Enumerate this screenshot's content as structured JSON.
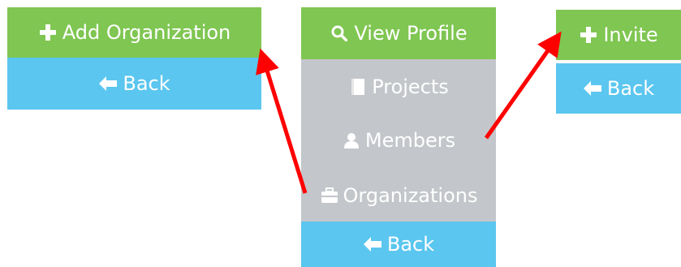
{
  "left": {
    "add_label": "Add Organization",
    "back_label": "Back"
  },
  "middle": {
    "view_profile_label": "View Profile",
    "projects_label": "Projects",
    "members_label": "Members",
    "organizations_label": "Organizations",
    "back_label": "Back"
  },
  "right": {
    "invite_label": "Invite",
    "back_label": "Back"
  },
  "icons": {
    "plus": "plus-icon",
    "back_arrow": "arrow-left-icon",
    "search": "search-icon",
    "book": "book-icon",
    "user": "user-icon",
    "briefcase": "briefcase-icon"
  },
  "colors": {
    "primary_green": "#7fc652",
    "back_blue": "#5bc6ef",
    "menu_grey": "#c3c6ca",
    "arrow_red": "#ff0000"
  }
}
